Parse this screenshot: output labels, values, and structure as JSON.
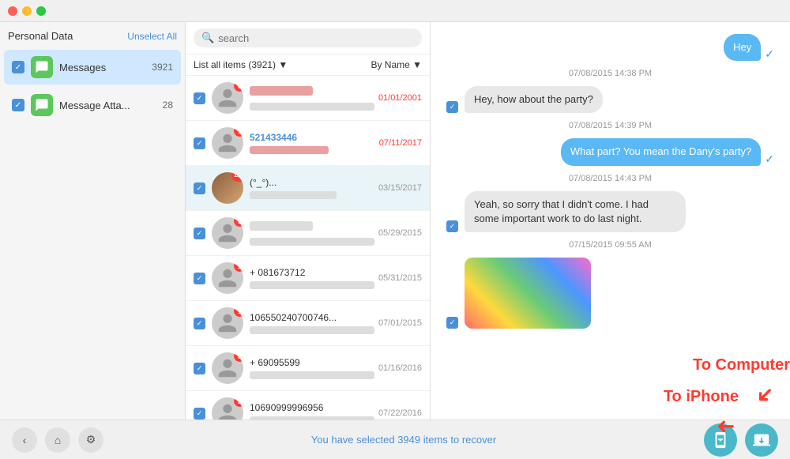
{
  "titlebar": {
    "red": "close",
    "yellow": "minimize",
    "green": "maximize"
  },
  "sidebar": {
    "title": "Personal Data",
    "unselect_label": "Unselect All",
    "items": [
      {
        "id": "messages",
        "label": "Messages",
        "count": "3921",
        "type": "messages"
      },
      {
        "id": "attachments",
        "label": "Message Atta...",
        "count": "28",
        "type": "attachments"
      }
    ]
  },
  "contact_list": {
    "search_placeholder": "search",
    "header_label": "List all items (3921) ▼",
    "sort_label": "By Name ▼",
    "contacts": [
      {
        "id": 1,
        "name_blurred": true,
        "name": "────────",
        "preview_blurred": true,
        "preview": "─────────",
        "date": "01/01/2001",
        "date_red": true,
        "badge": "0",
        "avatar_type": "person"
      },
      {
        "id": 2,
        "name_blurred": false,
        "name": "521433446",
        "preview_blurred": true,
        "preview": "─────────",
        "date": "07/11/2017",
        "date_red": true,
        "badge": "1",
        "avatar_type": "person"
      },
      {
        "id": 3,
        "name_blurred": false,
        "name": "(°_°)...",
        "preview_blurred": true,
        "preview": "─────────",
        "date": "03/15/2017",
        "date_red": false,
        "badge": "121",
        "avatar_type": "photo",
        "selected": true
      },
      {
        "id": 4,
        "name_blurred": true,
        "name": "────────",
        "preview_blurred": true,
        "preview": "─────────",
        "date": "05/29/2015",
        "date_red": false,
        "badge": "9",
        "avatar_type": "person"
      },
      {
        "id": 5,
        "name_blurred": false,
        "name": "+  081673712",
        "preview_blurred": true,
        "preview": "─────────",
        "date": "05/31/2015",
        "date_red": false,
        "badge": "1",
        "avatar_type": "person"
      },
      {
        "id": 6,
        "name_blurred": false,
        "name": "106550240700746...",
        "preview_blurred": true,
        "preview": "─────────",
        "date": "07/01/2015",
        "date_red": false,
        "badge": "1",
        "avatar_type": "person"
      },
      {
        "id": 7,
        "name_blurred": false,
        "name": "+   69095599",
        "preview_blurred": true,
        "preview": "─────────",
        "date": "01/16/2016",
        "date_red": false,
        "badge": "5",
        "avatar_type": "person"
      },
      {
        "id": 8,
        "name_blurred": false,
        "name": "10690999996956",
        "preview_blurred": true,
        "preview": "─────────",
        "date": "07/22/2016",
        "date_red": false,
        "badge": "2",
        "avatar_type": "person"
      }
    ]
  },
  "chat": {
    "messages": [
      {
        "id": 1,
        "type": "outgoing",
        "text": "Hey",
        "has_check": true
      },
      {
        "id": 2,
        "type": "timestamp",
        "text": "07/08/2015 14:38 PM"
      },
      {
        "id": 3,
        "type": "incoming",
        "text": "Hey,  how about the party?",
        "has_check": true
      },
      {
        "id": 4,
        "type": "timestamp",
        "text": "07/08/2015 14:39 PM"
      },
      {
        "id": 5,
        "type": "outgoing",
        "text": "What part? You mean the Dany's party?",
        "has_check": true
      },
      {
        "id": 6,
        "type": "timestamp",
        "text": "07/08/2015 14:43 PM"
      },
      {
        "id": 7,
        "type": "incoming",
        "text": "Yeah, so sorry that I didn't come. I had some important work to do last night.",
        "has_check": true
      },
      {
        "id": 8,
        "type": "timestamp",
        "text": "07/15/2015 09:55 AM"
      },
      {
        "id": 9,
        "type": "incoming",
        "is_image": true
      }
    ]
  },
  "bottom_bar": {
    "status_text": "You have selected ",
    "count": "3949",
    "status_suffix": " items to recover",
    "to_computer_label": "To Computer",
    "to_iphone_label": "To iPhone"
  },
  "bottom_buttons": {
    "back": "‹",
    "home": "⌂",
    "settings": "⚙"
  }
}
